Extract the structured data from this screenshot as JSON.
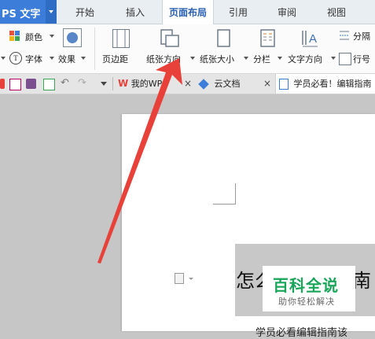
{
  "app": {
    "title": "PS 文字"
  },
  "menu_tabs": [
    {
      "label": "开始"
    },
    {
      "label": "插入"
    },
    {
      "label": "页面布局"
    },
    {
      "label": "引用"
    },
    {
      "label": "审阅"
    },
    {
      "label": "视图"
    }
  ],
  "ribbon": {
    "color_label": "颜色",
    "font_label": "字体",
    "effect_label": "效果",
    "margin_label": "页边距",
    "orientation_label": "纸张方向",
    "size_label": "纸张大小",
    "columns_label": "分栏",
    "text_direction_label": "文字方向",
    "separator_label": "分隔",
    "line_number_label": "行号"
  },
  "doc_tabs": [
    {
      "label": "我的WPS"
    },
    {
      "label": "云文档"
    },
    {
      "label": "学员必看！编辑指南"
    }
  ],
  "document": {
    "headline_left": "怎么",
    "headline_right": "南",
    "body_partial": "学员必看编辑指南该"
  },
  "watermark": {
    "title": "百科全说",
    "subtitle": "助你轻松解决"
  },
  "colors": {
    "accent": "#3b7dd8",
    "active_tab_text": "#2a5fb0",
    "watermark_green": "#19a55a",
    "arrow_red": "#e8413a"
  }
}
